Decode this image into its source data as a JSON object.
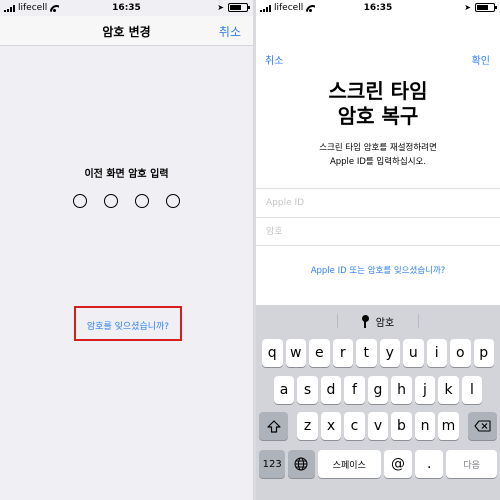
{
  "status_left": {
    "carrier": "lifecell",
    "time": "16:35"
  },
  "status_right": {
    "carrier": "lifecell",
    "time": "16:35"
  },
  "left_screen": {
    "title": "암호 변경",
    "cancel": "취소",
    "prompt": "이전 화면 암호 입력",
    "passcode_digits": 4,
    "forgot": "암호를 잊으셨습니까?"
  },
  "right_screen": {
    "cancel": "취소",
    "confirm": "확인",
    "title_line1": "스크린 타임",
    "title_line2": "암호 복구",
    "desc_line1": "스크린 타임 암호를 재설정하려면",
    "desc_line2": "Apple ID를 입력하십시오.",
    "apple_id_placeholder": "Apple ID",
    "password_placeholder": "암호",
    "forgot": "Apple ID 또는 암호를 잊으셨습니까?"
  },
  "keyboard": {
    "suggestion": "암호",
    "row1": [
      "q",
      "w",
      "e",
      "r",
      "t",
      "y",
      "u",
      "i",
      "o",
      "p"
    ],
    "row2": [
      "a",
      "s",
      "d",
      "f",
      "g",
      "h",
      "j",
      "k",
      "l"
    ],
    "row3": [
      "z",
      "x",
      "c",
      "v",
      "b",
      "n",
      "m"
    ],
    "key_123": "123",
    "space": "스페이스",
    "at": "@",
    "dot": ".",
    "next": "다음"
  }
}
